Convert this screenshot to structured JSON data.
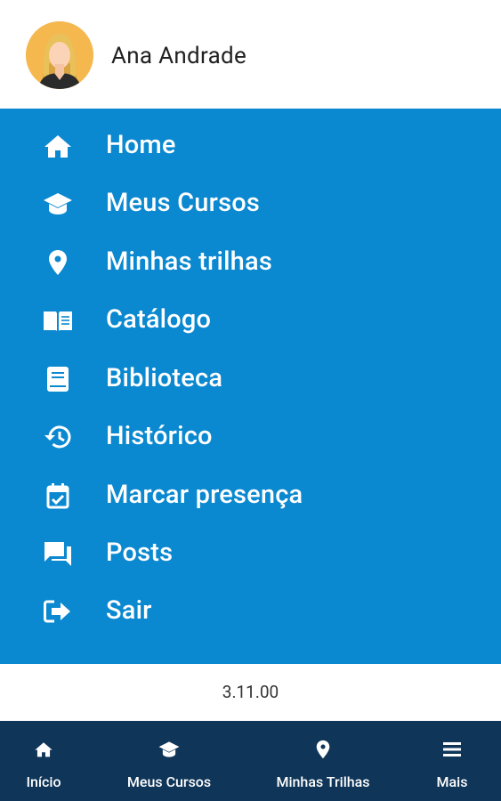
{
  "user": {
    "name": "Ana Andrade"
  },
  "menu": {
    "items": [
      {
        "label": "Home",
        "icon": "home-icon"
      },
      {
        "label": "Meus Cursos",
        "icon": "graduation-cap-icon"
      },
      {
        "label": "Minhas trilhas",
        "icon": "map-pin-icon"
      },
      {
        "label": "Catálogo",
        "icon": "open-book-icon"
      },
      {
        "label": "Biblioteca",
        "icon": "book-icon"
      },
      {
        "label": "Histórico",
        "icon": "history-icon"
      },
      {
        "label": "Marcar presença",
        "icon": "calendar-check-icon"
      },
      {
        "label": "Posts",
        "icon": "chat-bubbles-icon"
      },
      {
        "label": "Sair",
        "icon": "sign-out-icon"
      }
    ]
  },
  "version": "3.11.00",
  "bottom_nav": {
    "items": [
      {
        "label": "Início",
        "icon": "home-icon"
      },
      {
        "label": "Meus Cursos",
        "icon": "graduation-cap-icon"
      },
      {
        "label": "Minhas Trilhas",
        "icon": "map-pin-icon"
      },
      {
        "label": "Mais",
        "icon": "hamburger-menu-icon"
      }
    ]
  },
  "colors": {
    "menu_background": "#0a88d0",
    "bottom_nav_background": "#0f3558",
    "avatar_background": "#f5b84f"
  }
}
